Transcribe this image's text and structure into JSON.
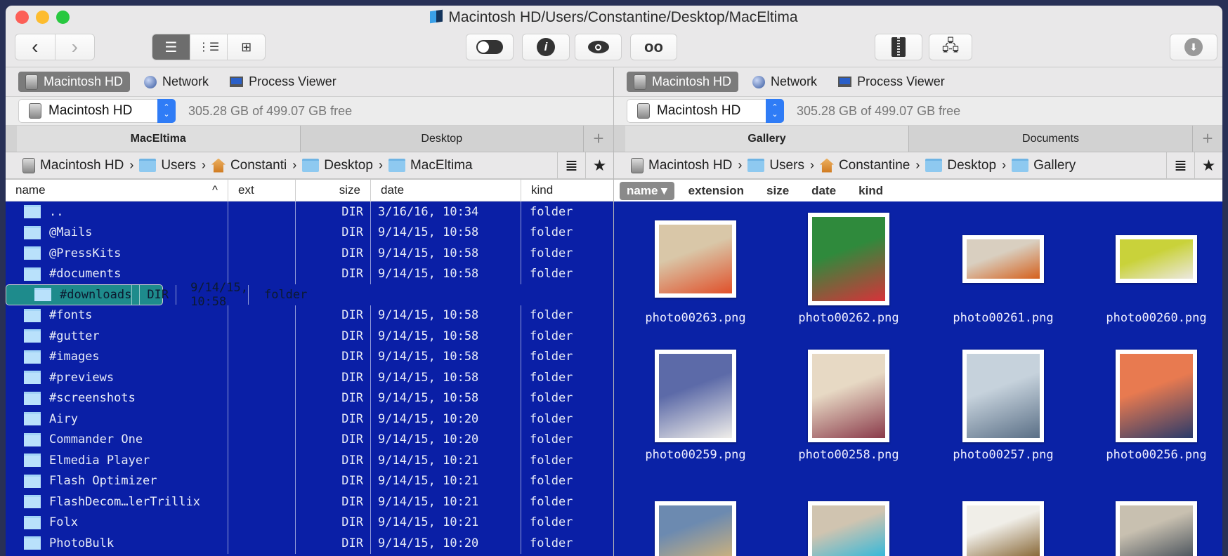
{
  "window": {
    "title": "Macintosh HD/Users/Constantine/Desktop/MacEltima"
  },
  "toolbar": {
    "back": "‹",
    "forward": "›",
    "info": "i",
    "download": "⬇"
  },
  "left": {
    "favorites": [
      "Macintosh HD",
      "Network",
      "Process Viewer"
    ],
    "drive": "Macintosh HD",
    "free": "305.28 GB of 499.07 GB free",
    "tabs": [
      "MacEltima",
      "Desktop"
    ],
    "plus": "+",
    "breadcrumb": [
      "Macintosh HD",
      "Users",
      "Constanti",
      "Desktop",
      "MacEltima"
    ],
    "columns": {
      "name": "name",
      "sort": "^",
      "ext": "ext",
      "size": "size",
      "date": "date",
      "kind": "kind"
    },
    "rows": [
      {
        "name": "..",
        "size": "DIR",
        "date": "3/16/16, 10:34",
        "kind": "folder"
      },
      {
        "name": "@Mails",
        "size": "DIR",
        "date": "9/14/15, 10:58",
        "kind": "folder"
      },
      {
        "name": "@PressKits",
        "size": "DIR",
        "date": "9/14/15, 10:58",
        "kind": "folder"
      },
      {
        "name": "#documents",
        "size": "DIR",
        "date": "9/14/15, 10:58",
        "kind": "folder"
      },
      {
        "name": "#downloads",
        "size": "DIR",
        "date": "9/14/15, 10:58",
        "kind": "folder",
        "selected": true
      },
      {
        "name": "#fonts",
        "size": "DIR",
        "date": "9/14/15, 10:58",
        "kind": "folder"
      },
      {
        "name": "#gutter",
        "size": "DIR",
        "date": "9/14/15, 10:58",
        "kind": "folder"
      },
      {
        "name": "#images",
        "size": "DIR",
        "date": "9/14/15, 10:58",
        "kind": "folder"
      },
      {
        "name": "#previews",
        "size": "DIR",
        "date": "9/14/15, 10:58",
        "kind": "folder"
      },
      {
        "name": "#screenshots",
        "size": "DIR",
        "date": "9/14/15, 10:58",
        "kind": "folder"
      },
      {
        "name": "Airy",
        "size": "DIR",
        "date": "9/14/15, 10:20",
        "kind": "folder"
      },
      {
        "name": "Commander One",
        "size": "DIR",
        "date": "9/14/15, 10:20",
        "kind": "folder"
      },
      {
        "name": "Elmedia Player",
        "size": "DIR",
        "date": "9/14/15, 10:21",
        "kind": "folder"
      },
      {
        "name": "Flash Optimizer",
        "size": "DIR",
        "date": "9/14/15, 10:21",
        "kind": "folder"
      },
      {
        "name": "FlashDecom…lerTrillix",
        "size": "DIR",
        "date": "9/14/15, 10:21",
        "kind": "folder"
      },
      {
        "name": "Folx",
        "size": "DIR",
        "date": "9/14/15, 10:21",
        "kind": "folder"
      },
      {
        "name": "PhotoBulk",
        "size": "DIR",
        "date": "9/14/15, 10:20",
        "kind": "folder"
      }
    ]
  },
  "right": {
    "favorites": [
      "Macintosh HD",
      "Network",
      "Process Viewer"
    ],
    "drive": "Macintosh HD",
    "free": "305.28 GB of 499.07 GB free",
    "tabs": [
      "Gallery",
      "Documents"
    ],
    "plus": "+",
    "breadcrumb": [
      "Macintosh HD",
      "Users",
      "Constantine",
      "Desktop",
      "Gallery"
    ],
    "columns": {
      "name": "name ▾",
      "extension": "extension",
      "size": "size",
      "date": "date",
      "kind": "kind"
    },
    "photos": [
      {
        "name": "photo00263.png",
        "colors": [
          "#d9c7a8",
          "#e0502a"
        ],
        "orient": "land"
      },
      {
        "name": "photo00262.png",
        "colors": [
          "#2f8a3c",
          "#d8323a"
        ],
        "orient": "port"
      },
      {
        "name": "photo00261.png",
        "colors": [
          "#d9cfc0",
          "#d5601c"
        ],
        "orient": "wide"
      },
      {
        "name": "photo00260.png",
        "colors": [
          "#c9d23a",
          "#ece8e0"
        ],
        "orient": "wide"
      },
      {
        "name": "photo00259.png",
        "colors": [
          "#5c6aa8",
          "#f0eeea"
        ],
        "orient": "port"
      },
      {
        "name": "photo00258.png",
        "colors": [
          "#e7d9c4",
          "#8a3a4a"
        ],
        "orient": "port"
      },
      {
        "name": "photo00257.png",
        "colors": [
          "#c6d2dc",
          "#5a6f86"
        ],
        "orient": "port"
      },
      {
        "name": "photo00256.png",
        "colors": [
          "#e87a50",
          "#2a3a6a"
        ],
        "orient": "port"
      },
      {
        "name": "",
        "colors": [
          "#6c8ab0",
          "#c8b080"
        ],
        "orient": "port"
      },
      {
        "name": "",
        "colors": [
          "#d0c4b0",
          "#38b8d8"
        ],
        "orient": "port"
      },
      {
        "name": "",
        "colors": [
          "#f0eee8",
          "#8a6a3a"
        ],
        "orient": "port"
      },
      {
        "name": "",
        "colors": [
          "#c8c0b0",
          "#505860"
        ],
        "orient": "port"
      }
    ]
  }
}
